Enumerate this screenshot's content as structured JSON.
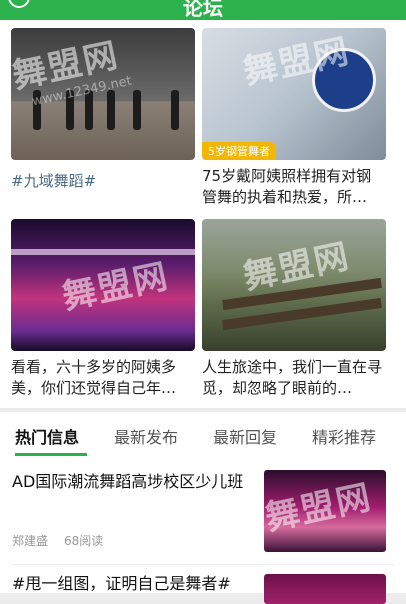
{
  "header": {
    "title": "论坛"
  },
  "grid": {
    "cards": [
      {
        "caption": "",
        "hashtag": "#九域舞蹈#",
        "badge": "",
        "image_alt": "dance rehearsal studio"
      },
      {
        "caption": "75岁戴阿姨照样拥有对钢管舞的执着和热爱，所…",
        "badge": "5岁钢管舞者",
        "image_alt": "pole dance badge IPSF"
      },
      {
        "caption": "看看，六十多岁的阿姨多美，你们还觉得自己年…",
        "badge": "",
        "image_alt": "stage performance with lights"
      },
      {
        "caption": "人生旅途中，我们一直在寻觅，却忽略了眼前的…",
        "badge": "",
        "image_alt": "park bench in autumn"
      }
    ]
  },
  "tabs": [
    "热门信息",
    "最新发布",
    "最新回复",
    "精彩推荐"
  ],
  "list": {
    "items": [
      {
        "title": "AD国际潮流舞蹈高埗校区少儿班",
        "author": "郑建盛",
        "reads": "68阅读"
      },
      {
        "title": "#甩一组图，证明自己是舞者#",
        "author": "",
        "reads": ""
      }
    ]
  },
  "watermark": {
    "logo_text": "舞盟网",
    "url_text": "www.12349.net"
  },
  "colors": {
    "brand_green": "#2bb24c",
    "hashtag_blue": "#4a6a86",
    "badge_yellow": "#f2b705"
  }
}
